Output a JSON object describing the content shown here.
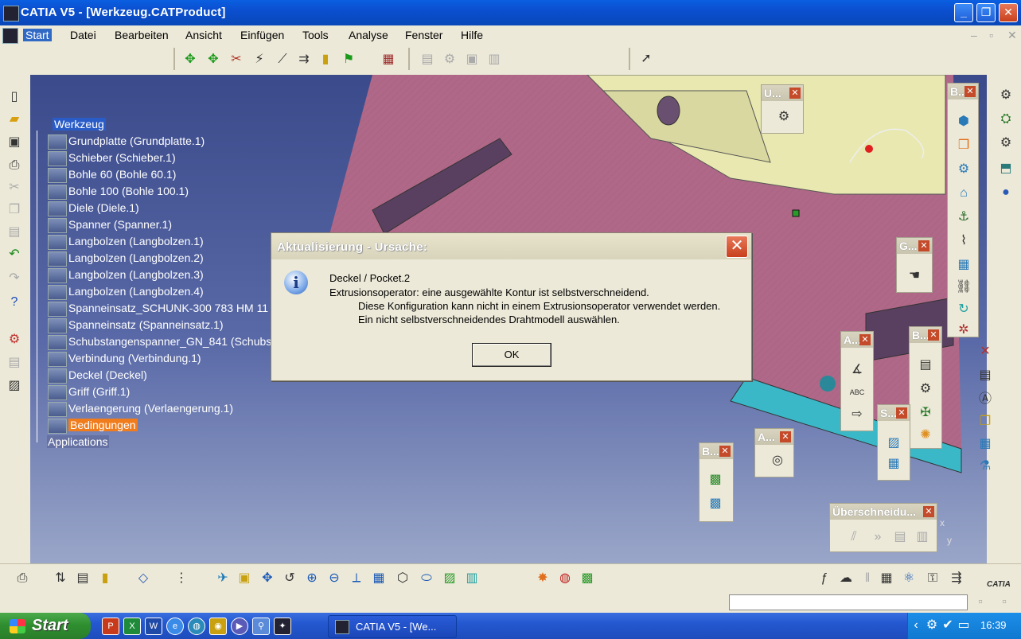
{
  "window": {
    "title": "CATIA V5 - [Werkzeug.CATProduct]",
    "minimize_glyph": "_",
    "restore_glyph": "❐",
    "close_glyph": "✕",
    "inner_min": "–",
    "inner_restore": "▫",
    "inner_close": "✕"
  },
  "menubar": [
    "Start",
    "Datei",
    "Bearbeiten",
    "Ansicht",
    "Einfügen",
    "Tools",
    "Analyse",
    "Fenster",
    "Hilfe"
  ],
  "tree": [
    "Werkzeug",
    "Grundplatte (Grundplatte.1)",
    "Schieber (Schieber.1)",
    "Bohle 60 (Bohle 60.1)",
    "Bohle 100 (Bohle 100.1)",
    "Diele (Diele.1)",
    "Spanner (Spanner.1)",
    "Langbolzen (Langbolzen.1)",
    "Langbolzen (Langbolzen.2)",
    "Langbolzen (Langbolzen.3)",
    "Langbolzen (Langbolzen.4)",
    "Spanneinsatz_SCHUNK-300 783 HM 11 (S",
    "Spanneinsatz (Spanneinsatz.1)",
    "Schubstangenspanner_GN_841 (Schubst",
    "Verbindung (Verbindung.1)",
    "Deckel (Deckel)",
    "Griff (Griff.1)",
    "Verlaengerung (Verlaengerung.1)",
    "Bedingungen",
    "Applications"
  ],
  "dialog": {
    "title": "Aktualisierung - Ursache:",
    "info_glyph": "i",
    "close_glyph": "✕",
    "line1": "Deckel / Pocket.2",
    "line2": "Extrusionsoperator: eine ausgewählte Kontur ist selbstverschneidend.",
    "line3": "Diese Konfiguration kann nicht in einem Extrusionsoperator verwendet werden.",
    "line4": "Ein nicht selbstverschneidendes Drahtmodell auswählen.",
    "ok_label": "OK"
  },
  "floating_toolbars": {
    "u": "U...",
    "b_right": "B...",
    "g": "G...",
    "a1": "A...",
    "b2": "B...",
    "s": "S...",
    "a2": "A...",
    "b3": "B...",
    "uber": "Überschneidu..."
  },
  "compass": {
    "x": "x",
    "y": "y"
  },
  "brand": "CATIA",
  "taskbar": {
    "start_label": "Start",
    "task_label": "CATIA V5 - [We...",
    "clock": "16:39"
  },
  "colors": {
    "accent": "#316ac5",
    "selection": "#f07c1c",
    "dialog_close": "#c8401c"
  }
}
